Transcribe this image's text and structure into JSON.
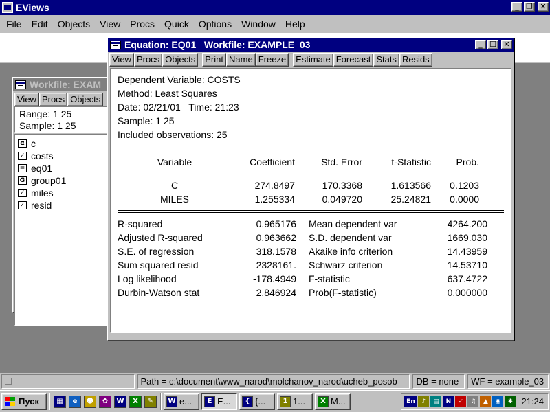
{
  "app": {
    "title": "EViews"
  },
  "menu": [
    "File",
    "Edit",
    "Objects",
    "View",
    "Procs",
    "Quick",
    "Options",
    "Window",
    "Help"
  ],
  "workfile_window": {
    "title": "Workfile: EXAM",
    "toolbar": [
      "View",
      "Procs",
      "Objects"
    ],
    "range": "Range:  1 25",
    "sample": "Sample:  1 25",
    "objects": [
      {
        "badge": "α",
        "name": "c"
      },
      {
        "badge": "✓",
        "name": "costs"
      },
      {
        "badge": "=",
        "name": "eq01"
      },
      {
        "badge": "G",
        "name": "group01"
      },
      {
        "badge": "✓",
        "name": "miles"
      },
      {
        "badge": "✓",
        "name": "resid"
      }
    ]
  },
  "equation_window": {
    "title": "Equation: EQ01   Workfile: EXAMPLE_03",
    "toolbar": [
      "View",
      "Procs",
      "Objects",
      "Print",
      "Name",
      "Freeze",
      "Estimate",
      "Forecast",
      "Stats",
      "Resids"
    ],
    "dependent": "Dependent Variable: COSTS",
    "method": "Method: Least Squares",
    "date": "Date: 02/21/01   Time: 21:23",
    "sample": "Sample: 1 25",
    "observations": "Included observations: 25",
    "columns": [
      "Variable",
      "Coefficient",
      "Std. Error",
      "t-Statistic",
      "Prob."
    ],
    "coefficients": [
      {
        "var": "C",
        "coef": "274.8497",
        "se": "170.3368",
        "t": "1.613566",
        "p": "0.1203"
      },
      {
        "var": "MILES",
        "coef": "1.255334",
        "se": "0.049720",
        "t": "25.24821",
        "p": "0.0000"
      }
    ],
    "stats": [
      {
        "l1": "R-squared",
        "v1": "0.965176",
        "l2": "Mean dependent var",
        "v2": "4264.200"
      },
      {
        "l1": "Adjusted R-squared",
        "v1": "0.963662",
        "l2": "S.D. dependent var",
        "v2": "1669.030"
      },
      {
        "l1": "S.E. of regression",
        "v1": "318.1578",
        "l2": "Akaike info criterion",
        "v2": "14.43959"
      },
      {
        "l1": "Sum squared resid",
        "v1": "2328161.",
        "l2": "Schwarz criterion",
        "v2": "14.53710"
      },
      {
        "l1": "Log likelihood",
        "v1": "-178.4949",
        "l2": "F-statistic",
        "v2": "637.4722"
      },
      {
        "l1": "Durbin-Watson stat",
        "v1": "2.846924",
        "l2": "Prob(F-statistic)",
        "v2": "0.000000"
      }
    ]
  },
  "statusbar": {
    "path": "Path = c:\\document\\www_narod\\molchanov_narod\\ucheb_posob",
    "db": "DB = none",
    "wf": "WF = example_03"
  },
  "taskbar": {
    "start_label": "Пуск",
    "tasks": [
      {
        "label": "e...",
        "color": "#000080",
        "icon": "W"
      },
      {
        "label": "E...",
        "color": "#000080",
        "icon": "E"
      },
      {
        "label": "{...",
        "color": "#000080",
        "icon": "{"
      },
      {
        "label": "1...",
        "color": "#808000",
        "icon": "1"
      },
      {
        "label": "M...",
        "color": "#008000",
        "icon": "X"
      }
    ],
    "lang": "En",
    "clock": "21:24"
  }
}
